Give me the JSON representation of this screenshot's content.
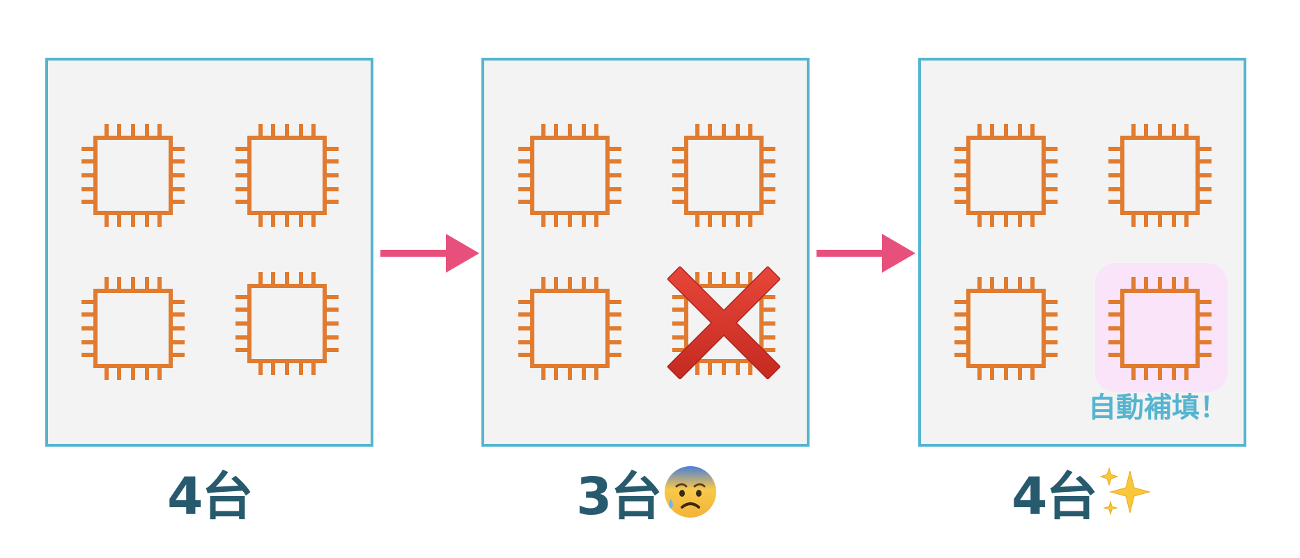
{
  "panels": [
    {
      "label": "4台",
      "chip_count": 4,
      "failed_chips": 0,
      "auto_filled_chips": 0
    },
    {
      "label": "3台",
      "chip_count": 4,
      "failed_chips": 1,
      "auto_filled_chips": 0,
      "emoji": "anxious-face-with-sweat-icon"
    },
    {
      "label": "4台",
      "chip_count": 4,
      "failed_chips": 0,
      "auto_filled_chips": 1,
      "emoji": "sparkles-icon",
      "callout": "自動補填！"
    }
  ],
  "colors": {
    "panel_border": "#56b4cf",
    "panel_fill": "#f3f3f3",
    "chip": "#e07b2f",
    "arrow": "#e8507c",
    "cross": "#d8352a",
    "label_text": "#285a6e",
    "callout_text": "#56b4cf",
    "highlight": "#f9e4fa"
  },
  "icons": {
    "chip": "cpu-chip-icon",
    "failure": "red-cross-icon",
    "transition": "right-arrow-icon"
  }
}
